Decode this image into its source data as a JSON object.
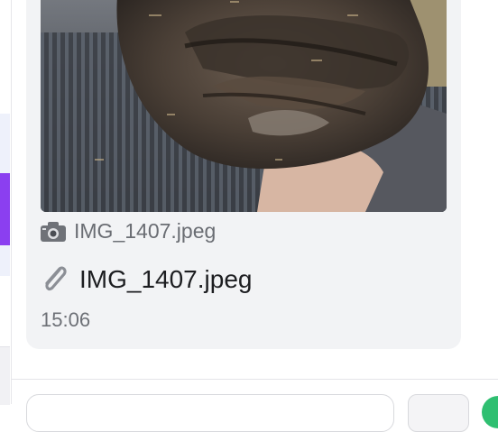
{
  "message": {
    "image_icon": "camera-icon",
    "image_filename": "IMG_1407.jpeg",
    "attachment_icon": "paperclip-icon",
    "attachment_filename": "IMG_1407.jpeg",
    "timestamp": "15:06"
  },
  "colors": {
    "bubble_bg": "#f2f3f5",
    "sidebar_accent": "#8b3ff0",
    "send_button": "#2fbf71"
  }
}
